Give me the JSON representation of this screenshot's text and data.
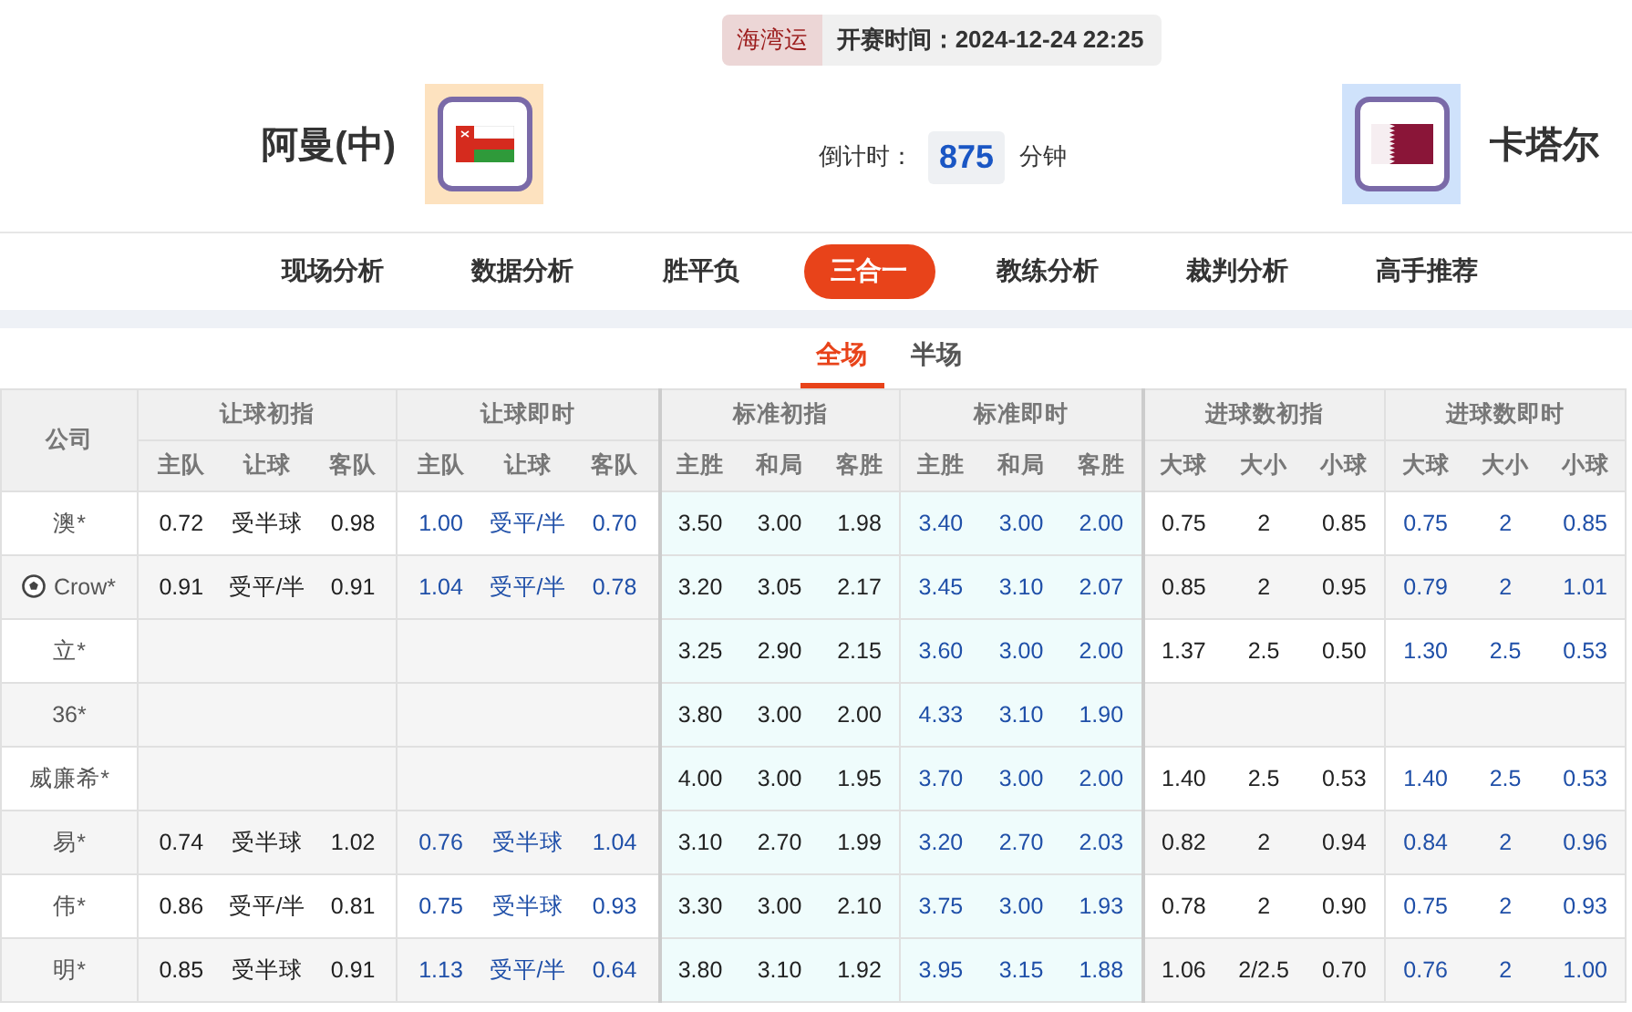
{
  "match": {
    "tag": "海湾运",
    "kickoff_label": "开赛时间：",
    "kickoff": "2024-12-24 22:25",
    "home": {
      "name": "阿曼(中)"
    },
    "away": {
      "name": "卡塔尔"
    },
    "countdown_label": "倒计时：",
    "countdown": "875",
    "countdown_unit": "分钟"
  },
  "nav": [
    {
      "label": "现场分析",
      "selected": false
    },
    {
      "label": "数据分析",
      "selected": false
    },
    {
      "label": "胜平负",
      "selected": false
    },
    {
      "label": "三合一",
      "selected": true
    },
    {
      "label": "教练分析",
      "selected": false
    },
    {
      "label": "裁判分析",
      "selected": false
    },
    {
      "label": "高手推荐",
      "selected": false
    }
  ],
  "subtabs": [
    {
      "label": "全场",
      "selected": true
    },
    {
      "label": "半场",
      "selected": false
    }
  ],
  "table": {
    "company_header": "公司",
    "groups": [
      {
        "title": "让球初指",
        "kind": "initial",
        "columns": [
          "主队",
          "让球",
          "客队"
        ]
      },
      {
        "title": "让球即时",
        "kind": "live",
        "columns": [
          "主队",
          "让球",
          "客队"
        ]
      },
      {
        "title": "标准初指",
        "kind": "initial",
        "columns": [
          "主胜",
          "和局",
          "客胜"
        ]
      },
      {
        "title": "标准即时",
        "kind": "live",
        "columns": [
          "主胜",
          "和局",
          "客胜"
        ]
      },
      {
        "title": "进球数初指",
        "kind": "initial",
        "columns": [
          "大球",
          "大小",
          "小球"
        ]
      },
      {
        "title": "进球数即时",
        "kind": "live",
        "columns": [
          "大球",
          "大小",
          "小球"
        ]
      }
    ],
    "rows": [
      {
        "company": "澳*",
        "kind": "plain",
        "groups": [
          {
            "kind": "odds",
            "values": [
              "0.72",
              "受半球",
              "0.98"
            ]
          },
          {
            "kind": "odds",
            "values": [
              "1.00",
              "受平/半",
              "0.70"
            ]
          },
          {
            "kind": "odds",
            "values": [
              "3.50",
              "3.00",
              "1.98"
            ]
          },
          {
            "kind": "odds",
            "values": [
              "3.40",
              "3.00",
              "2.00"
            ]
          },
          {
            "kind": "odds",
            "values": [
              "0.75",
              "2",
              "0.85"
            ]
          },
          {
            "kind": "odds",
            "values": [
              "0.75",
              "2",
              "0.85"
            ]
          }
        ]
      },
      {
        "company": "Crow*",
        "kind": "with_icon",
        "groups": [
          {
            "kind": "odds",
            "values": [
              "0.91",
              "受平/半",
              "0.91"
            ]
          },
          {
            "kind": "odds",
            "values": [
              "1.04",
              "受平/半",
              "0.78"
            ]
          },
          {
            "kind": "odds",
            "values": [
              "3.20",
              "3.05",
              "2.17"
            ]
          },
          {
            "kind": "odds",
            "values": [
              "3.45",
              "3.10",
              "2.07"
            ]
          },
          {
            "kind": "odds",
            "values": [
              "0.85",
              "2",
              "0.95"
            ]
          },
          {
            "kind": "odds",
            "values": [
              "0.79",
              "2",
              "1.01"
            ]
          }
        ]
      },
      {
        "company": "立*",
        "kind": "plain",
        "groups": [
          {
            "kind": "blank"
          },
          {
            "kind": "blank"
          },
          {
            "kind": "odds",
            "values": [
              "3.25",
              "2.90",
              "2.15"
            ]
          },
          {
            "kind": "odds",
            "values": [
              "3.60",
              "3.00",
              "2.00"
            ]
          },
          {
            "kind": "odds",
            "values": [
              "1.37",
              "2.5",
              "0.50"
            ]
          },
          {
            "kind": "odds",
            "values": [
              "1.30",
              "2.5",
              "0.53"
            ]
          }
        ]
      },
      {
        "company": "36*",
        "kind": "plain",
        "groups": [
          {
            "kind": "blank"
          },
          {
            "kind": "blank"
          },
          {
            "kind": "odds",
            "values": [
              "3.80",
              "3.00",
              "2.00"
            ]
          },
          {
            "kind": "odds",
            "values": [
              "4.33",
              "3.10",
              "1.90"
            ]
          },
          {
            "kind": "blank"
          },
          {
            "kind": "blank"
          }
        ]
      },
      {
        "company": "威廉希*",
        "kind": "plain",
        "groups": [
          {
            "kind": "blank"
          },
          {
            "kind": "blank"
          },
          {
            "kind": "odds",
            "values": [
              "4.00",
              "3.00",
              "1.95"
            ]
          },
          {
            "kind": "odds",
            "values": [
              "3.70",
              "3.00",
              "2.00"
            ]
          },
          {
            "kind": "odds",
            "values": [
              "1.40",
              "2.5",
              "0.53"
            ]
          },
          {
            "kind": "odds",
            "values": [
              "1.40",
              "2.5",
              "0.53"
            ]
          }
        ]
      },
      {
        "company": "易*",
        "kind": "plain",
        "groups": [
          {
            "kind": "odds",
            "values": [
              "0.74",
              "受半球",
              "1.02"
            ]
          },
          {
            "kind": "odds",
            "values": [
              "0.76",
              "受半球",
              "1.04"
            ]
          },
          {
            "kind": "odds",
            "values": [
              "3.10",
              "2.70",
              "1.99"
            ]
          },
          {
            "kind": "odds",
            "values": [
              "3.20",
              "2.70",
              "2.03"
            ]
          },
          {
            "kind": "odds",
            "values": [
              "0.82",
              "2",
              "0.94"
            ]
          },
          {
            "kind": "odds",
            "values": [
              "0.84",
              "2",
              "0.96"
            ]
          }
        ]
      },
      {
        "company": "伟*",
        "kind": "plain",
        "groups": [
          {
            "kind": "odds",
            "values": [
              "0.86",
              "受平/半",
              "0.81"
            ]
          },
          {
            "kind": "odds",
            "values": [
              "0.75",
              "受半球",
              "0.93"
            ]
          },
          {
            "kind": "odds",
            "values": [
              "3.30",
              "3.00",
              "2.10"
            ]
          },
          {
            "kind": "odds",
            "values": [
              "3.75",
              "3.00",
              "1.93"
            ]
          },
          {
            "kind": "odds",
            "values": [
              "0.78",
              "2",
              "0.90"
            ]
          },
          {
            "kind": "odds",
            "values": [
              "0.75",
              "2",
              "0.93"
            ]
          }
        ]
      },
      {
        "company": "明*",
        "kind": "plain",
        "groups": [
          {
            "kind": "odds",
            "values": [
              "0.85",
              "受半球",
              "0.91"
            ]
          },
          {
            "kind": "odds",
            "values": [
              "1.13",
              "受平/半",
              "0.64"
            ]
          },
          {
            "kind": "odds",
            "values": [
              "3.80",
              "3.10",
              "1.92"
            ]
          },
          {
            "kind": "odds",
            "values": [
              "3.95",
              "3.15",
              "1.88"
            ]
          },
          {
            "kind": "odds",
            "values": [
              "1.06",
              "2/2.5",
              "0.70"
            ]
          },
          {
            "kind": "odds",
            "values": [
              "0.76",
              "2",
              "1.00"
            ]
          }
        ]
      }
    ]
  }
}
